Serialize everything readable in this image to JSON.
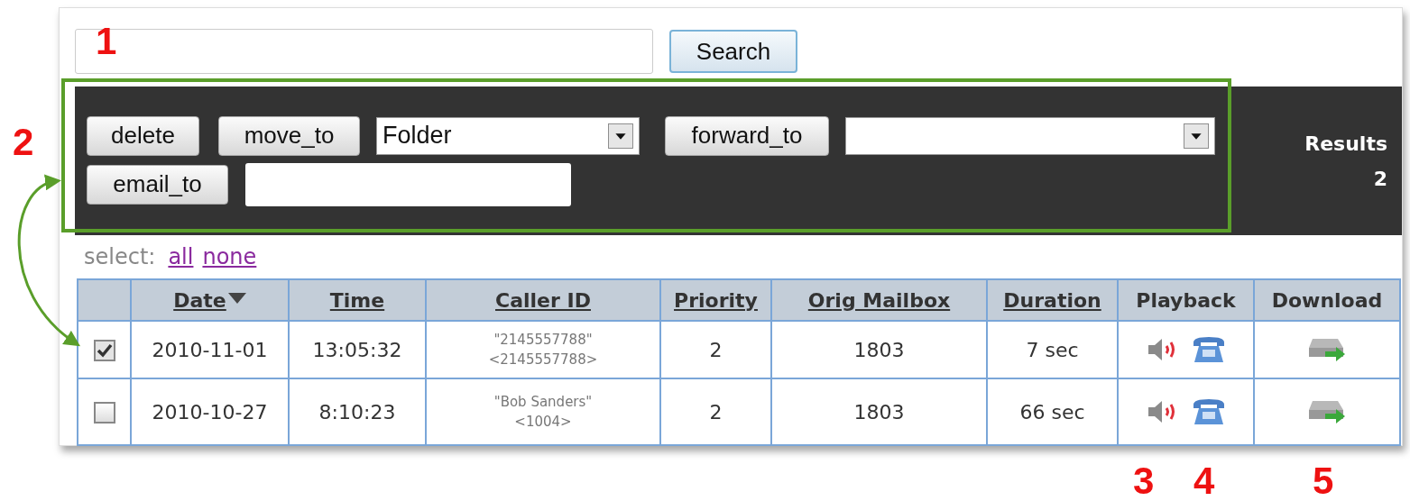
{
  "search": {
    "button": "Search"
  },
  "toolbar": {
    "actions": [
      {
        "kind": "button",
        "label": "delete"
      },
      {
        "kind": "button",
        "label": "move_to"
      },
      {
        "kind": "select",
        "value": "Folder"
      },
      {
        "kind": "button",
        "label": "forward_to"
      },
      {
        "kind": "select"
      },
      {
        "kind": "button",
        "label": "email_to"
      },
      {
        "kind": "input"
      }
    ],
    "results": {
      "label": "Results",
      "count": "2"
    }
  },
  "select_links": {
    "label": "select:",
    "links": [
      "all",
      "none"
    ]
  },
  "table": {
    "columns": [
      {
        "label": "Date",
        "link": true,
        "sorted": true
      },
      {
        "label": "Time",
        "link": true,
        "sorted": false
      },
      {
        "label": "Caller ID",
        "link": true,
        "sorted": false
      },
      {
        "label": "Priority",
        "link": true,
        "sorted": false
      },
      {
        "label": "Orig Mailbox",
        "link": true,
        "sorted": false
      },
      {
        "label": "Duration",
        "link": true,
        "sorted": false
      },
      {
        "label": "Playback",
        "link": false,
        "sorted": false
      },
      {
        "label": "Download",
        "link": false,
        "sorted": false
      }
    ],
    "rows": [
      {
        "checked": true,
        "date": "2010-11-01",
        "time": "13:05:32",
        "caller_name": "\"2145557788\"",
        "caller_number": "<2145557788>",
        "priority": "2",
        "orig_mailbox": "1803",
        "duration": "7 sec"
      },
      {
        "checked": false,
        "date": "2010-10-27",
        "time": "8:10:23",
        "caller_name": "\"Bob Sanders\"",
        "caller_number": "<1004>",
        "priority": "2",
        "orig_mailbox": "1803",
        "duration": "66 sec"
      }
    ]
  },
  "annotations": [
    {
      "label": "1"
    },
    {
      "label": "2"
    },
    {
      "label": "3"
    },
    {
      "label": "4"
    },
    {
      "label": "5"
    }
  ]
}
